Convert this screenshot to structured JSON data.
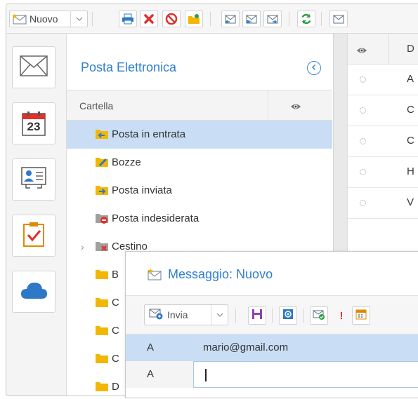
{
  "toolbar": {
    "new_label": "Nuovo",
    "icons": [
      "new-message-icon",
      "print-icon",
      "delete-icon",
      "block-icon",
      "move-to-folder-icon",
      "reply-icon",
      "reply-all-icon",
      "forward-icon",
      "refresh-icon",
      "more-icon"
    ]
  },
  "rail": {
    "items": [
      "mail-icon",
      "calendar-icon",
      "contacts-icon",
      "tasks-icon",
      "cloud-icon"
    ],
    "calendar_day": "23"
  },
  "folders": {
    "title": "Posta Elettronica",
    "column_header": "Cartella",
    "items": [
      {
        "label": "Posta in entrata",
        "selected": true
      },
      {
        "label": "Bozze"
      },
      {
        "label": "Posta inviata"
      },
      {
        "label": "Posta indesiderata"
      },
      {
        "label": "Cestino"
      },
      {
        "label": "B"
      },
      {
        "label": "C"
      },
      {
        "label": "C"
      },
      {
        "label": "C"
      },
      {
        "label": "D"
      }
    ]
  },
  "messages": {
    "header_col": "D",
    "rows": [
      "A",
      "C",
      "C",
      "H",
      "V"
    ]
  },
  "compose": {
    "title": "Messaggio: Nuovo",
    "send_label": "Invia",
    "recipients": [
      {
        "field": "A",
        "value": "mario@gmail.com"
      },
      {
        "field": "A",
        "value": ""
      }
    ]
  },
  "colors": {
    "accent": "#2f7fd0",
    "selection": "#c9def5",
    "delete": "#e0312b",
    "refresh": "#2ea043"
  }
}
